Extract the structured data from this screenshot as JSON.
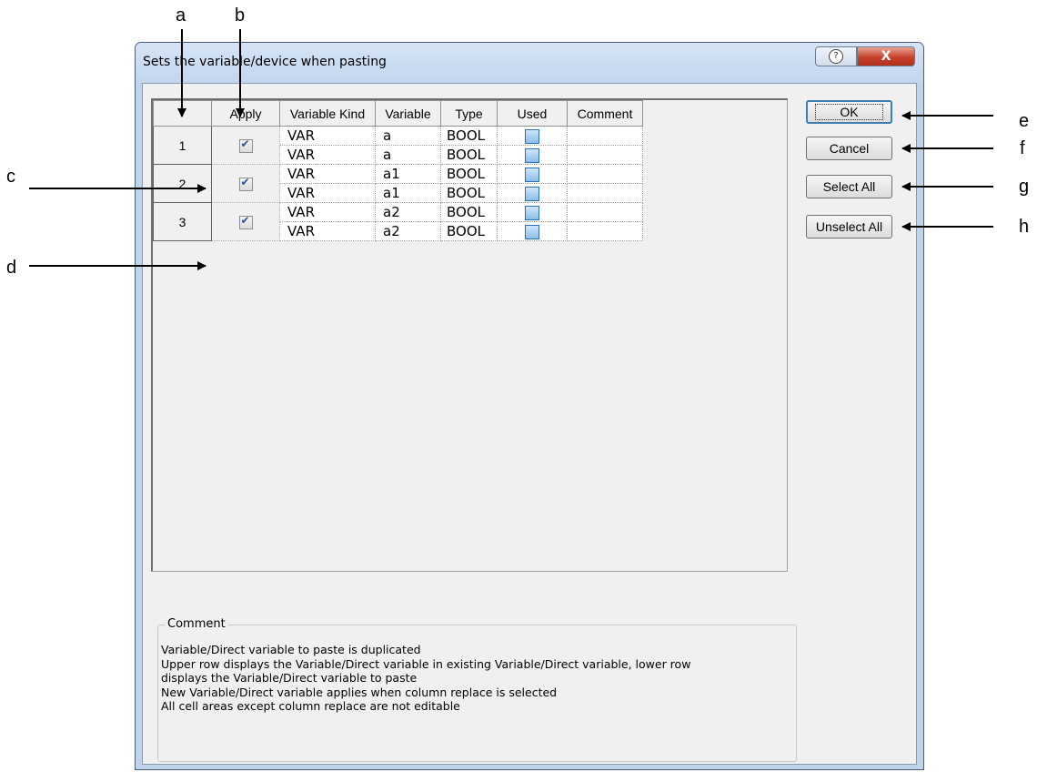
{
  "window": {
    "title": "Sets the variable/device when pasting",
    "help_glyph": "?",
    "close_glyph": "X"
  },
  "grid": {
    "headers": [
      "",
      "Apply",
      "Variable Kind",
      "Variable",
      "Type",
      "Used",
      "Comment"
    ],
    "groups": [
      {
        "num": "1",
        "apply_checked": true,
        "rows": [
          {
            "kind": "VAR",
            "variable": "a",
            "type": "BOOL",
            "used": false,
            "comment": ""
          },
          {
            "kind": "VAR",
            "variable": "a",
            "type": "BOOL",
            "used": false,
            "comment": ""
          }
        ]
      },
      {
        "num": "2",
        "apply_checked": true,
        "rows": [
          {
            "kind": "VAR",
            "variable": "a1",
            "type": "BOOL",
            "used": false,
            "comment": ""
          },
          {
            "kind": "VAR",
            "variable": "a1",
            "type": "BOOL",
            "used": false,
            "comment": ""
          }
        ]
      },
      {
        "num": "3",
        "apply_checked": true,
        "rows": [
          {
            "kind": "VAR",
            "variable": "a2",
            "type": "BOOL",
            "used": false,
            "comment": ""
          },
          {
            "kind": "VAR",
            "variable": "a2",
            "type": "BOOL",
            "used": false,
            "comment": ""
          }
        ]
      }
    ]
  },
  "buttons": {
    "ok": "OK",
    "cancel": "Cancel",
    "select_all": "Select All",
    "unselect_all": "Unselect All"
  },
  "comment": {
    "title": "Comment",
    "lines": [
      "Variable/Direct variable to paste is duplicated",
      "Upper row displays the Variable/Direct variable in existing Variable/Direct variable, lower row",
      "displays the Variable/Direct variable to paste",
      "New Variable/Direct variable applies when column replace is selected",
      "All cell areas except column replace are not editable"
    ]
  },
  "callouts": {
    "a": "a",
    "b": "b",
    "c": "c",
    "d": "d",
    "e": "e",
    "f": "f",
    "g": "g",
    "h": "h"
  },
  "colors": {
    "title_bar": "#c9dbf0",
    "close_button": "#c7422c",
    "client_bg": "#f0f0f0",
    "checkbox_blue": "#8bbde9"
  }
}
